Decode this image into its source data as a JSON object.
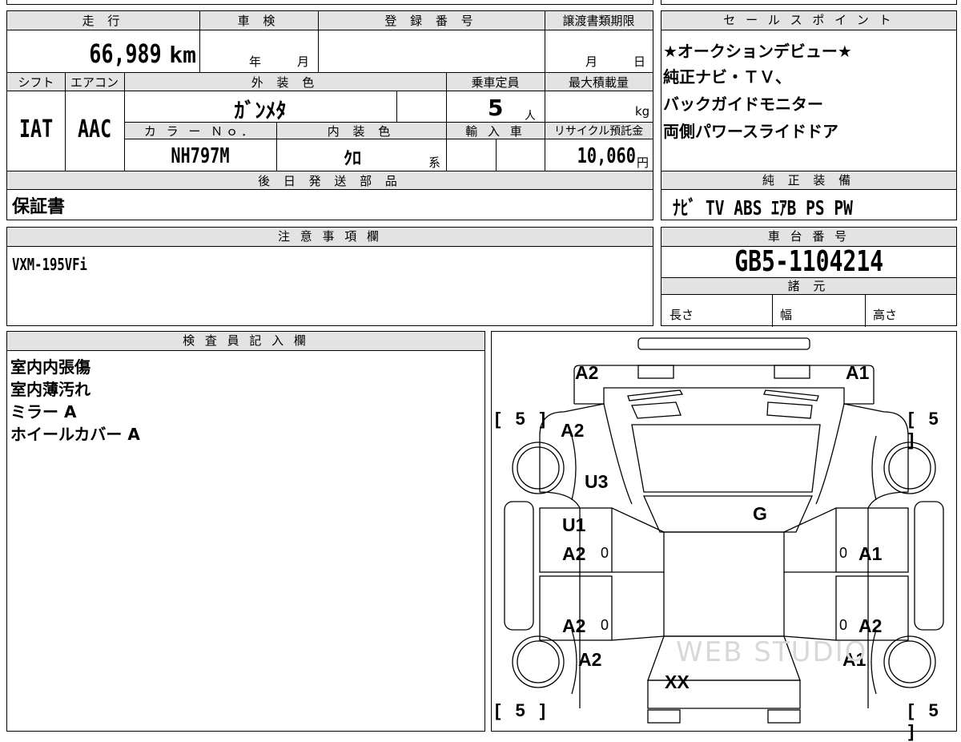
{
  "vehicle": {
    "mileage_label": "走 行",
    "mileage_value": "66,989",
    "mileage_unit": "km",
    "inspection_label": "車 検",
    "inspection_year_unit": "年",
    "inspection_month_unit": "月",
    "registration_label": "登 録 番 号",
    "registration_value": "",
    "transfer_label": "譲渡書類期限",
    "transfer_month_unit": "月",
    "transfer_day_unit": "日",
    "shift_label": "シフト",
    "shift_value": "IAT",
    "ac_label": "エアコン",
    "ac_value": "AAC",
    "exterior_label": "外 装 色",
    "exterior_value": "ｶﾞﾝﾒﾀ",
    "capacity_label": "乗車定員",
    "capacity_value": "5",
    "capacity_unit": "人",
    "max_load_label": "最大積載量",
    "max_load_unit": "kg",
    "color_no_label": "カ ラ ー Ｎｏ．",
    "color_no_value": "NH797M",
    "interior_label": "内 装 色",
    "interior_value": "ｸﾛ",
    "interior_suffix": "系",
    "import_label": "輸 入 車",
    "recycle_label": "リサイクル預託金",
    "recycle_value": "10,060",
    "recycle_unit": "円",
    "later_parts_label": "後 日 発 送 部 品",
    "later_parts_value": "保証書"
  },
  "sales_points": {
    "label": "セ ー ル ス ポ イ ン ト",
    "lines": [
      "★オークションデビュー★",
      "純正ナビ・ＴＶ、",
      "バックガイドモニター",
      "両側パワースライドドア"
    ]
  },
  "equipment": {
    "label": "純 正 装 備",
    "value": "ﾅﾋﾞ TV ABS ｴｱB PS PW"
  },
  "notes": {
    "label": "注 意 事 項 欄",
    "value": "VXM-195VFi"
  },
  "chassis": {
    "label": "車 台 番 号",
    "value": "GB5-1104214",
    "specs_label": "諸 元",
    "length_label": "長さ",
    "width_label": "幅",
    "height_label": "高さ"
  },
  "inspector": {
    "label": "検 査 員 記 入 欄",
    "lines": [
      "室内内張傷",
      "室内薄汚れ",
      "ミラー A",
      "ホイールカバー A"
    ]
  },
  "diagram": {
    "tire_fl": "[ 5 ]",
    "tire_fr": "[ 5 ]",
    "tire_rl": "[ 5 ]",
    "tire_rr": "[ 5 ]",
    "mark_front_left": "A2",
    "mark_front_right": "A1",
    "mark_left_fender": "A2",
    "mark_left_pillar": "U3",
    "mark_windshield": "G",
    "mark_left_front_door_1": "U1",
    "mark_left_front_door_2": "A2",
    "mark_right_front_door": "A1",
    "mark_left_rear_door": "A2",
    "mark_right_rear_door": "A2",
    "mark_left_quarter": "A2",
    "mark_right_quarter": "A1",
    "mark_rear_gate": "XX",
    "zero": "0",
    "watermark": "WEB STUDIO"
  }
}
